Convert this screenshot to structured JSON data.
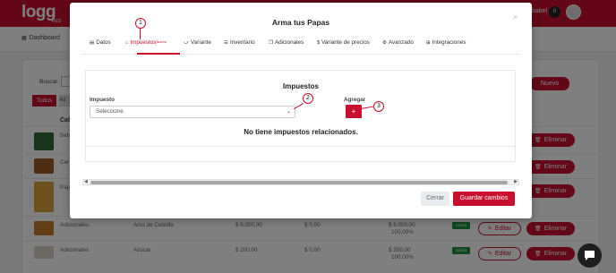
{
  "app": {
    "logo": "logg",
    "logo_sub": "RES",
    "user_name": "babel",
    "notif_count": "0",
    "nav_dashboard": "Dashboard"
  },
  "background": {
    "search_label": "Buscar:",
    "new_button": "Nuevo",
    "filter_all": "Todos",
    "filter_next": "Ad",
    "column_header": "Cat",
    "rows": [
      {
        "category": "Beb",
        "name": "",
        "price": "",
        "price2": "",
        "total": "",
        "pct": "",
        "status": "",
        "edit": "",
        "delete": "Eliminar"
      },
      {
        "category": "Cer",
        "name": "",
        "price": "",
        "price2": "",
        "total": "",
        "pct": "",
        "status": "",
        "edit": "",
        "delete": "Eliminar"
      },
      {
        "category": "Pap",
        "name": "",
        "price": "",
        "price2": "",
        "total": "",
        "pct": "",
        "status": "",
        "edit": "",
        "delete": "Eliminar"
      },
      {
        "category": "Adicionales",
        "name": "Aros de Cebolla",
        "price": "$ 6.000,00",
        "price2": "$ 0,00",
        "total": "$ 6.000,00",
        "pct": "100,00%",
        "status": "Activa",
        "edit": "Editar",
        "delete": "Eliminar"
      },
      {
        "category": "Adicionales",
        "name": "Azúcar",
        "price": "$ 200,00",
        "price2": "$ 0,00",
        "total": "$ 200,00",
        "pct": "100,00%",
        "status": "Activa",
        "edit": "Editar",
        "delete": "Eliminar"
      }
    ]
  },
  "modal": {
    "title": "Arma tus Papas",
    "close": "×",
    "tabs": [
      {
        "label": "Datos",
        "icon": "document-icon",
        "glyph": "▤"
      },
      {
        "label": "Impuestos",
        "sup": "Nuevo",
        "icon": "bank-icon",
        "glyph": "⌂"
      },
      {
        "label": "Variante",
        "icon": "variant-icon",
        "glyph": "⤻"
      },
      {
        "label": "Inventario",
        "icon": "list-icon",
        "glyph": "☰"
      },
      {
        "label": "Adicionales",
        "icon": "copy-icon",
        "glyph": "❐"
      },
      {
        "label": "Variante de precios",
        "icon": "dollar-icon",
        "glyph": "$"
      },
      {
        "label": "Avanzado",
        "icon": "gear-icon",
        "glyph": "⚙"
      },
      {
        "label": "Integraciones",
        "icon": "grid-icon",
        "glyph": "⊞"
      }
    ],
    "panel_title": "Impuestos",
    "tax_label": "Impuesto",
    "tax_placeholder": "Seleccione",
    "add_label": "Agregar",
    "add_button": "+",
    "empty_message": "No tiene impuestos relacionados.",
    "cancel_button": "Cerrar",
    "save_button": "Guardar cambios"
  },
  "callouts": [
    "1",
    "2",
    "3"
  ],
  "colors": {
    "brand": "#c8102e",
    "status_active": "#1e8e3e"
  }
}
